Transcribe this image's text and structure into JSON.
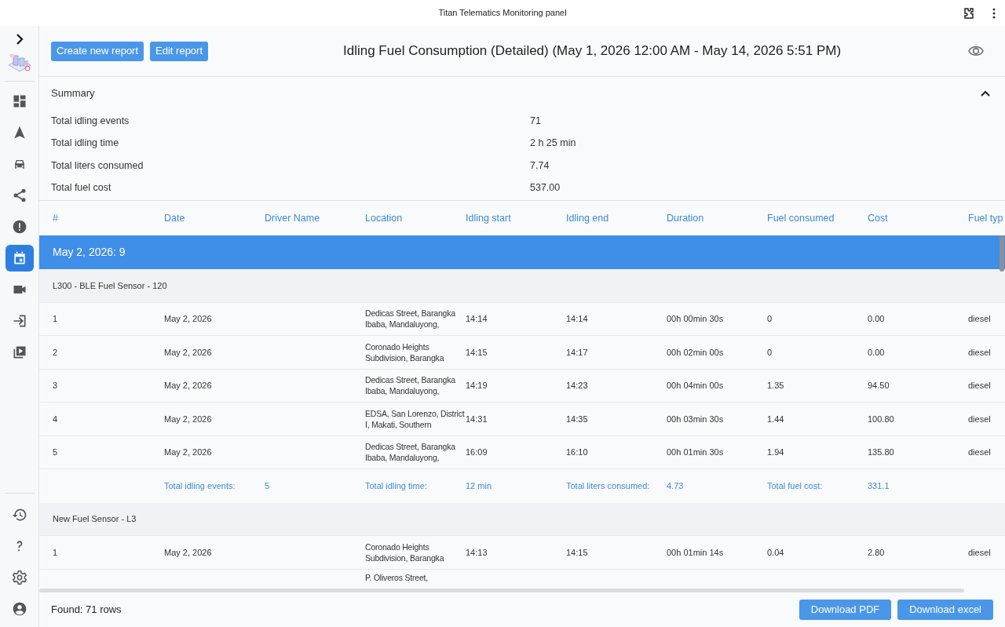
{
  "window": {
    "title": "Titan Telematics Monitoring panel"
  },
  "sidebar": {
    "items": [
      {
        "kind": "dashboard",
        "selected": false
      },
      {
        "kind": "navigation",
        "selected": false
      },
      {
        "kind": "car",
        "selected": false
      },
      {
        "kind": "share",
        "selected": false
      },
      {
        "kind": "alert",
        "selected": false
      },
      {
        "kind": "calendar",
        "selected": true
      },
      {
        "kind": "video",
        "selected": false
      },
      {
        "kind": "login",
        "selected": false
      },
      {
        "kind": "library",
        "selected": false
      }
    ],
    "bottom_items": [
      {
        "kind": "history"
      },
      {
        "kind": "help"
      },
      {
        "kind": "settings"
      },
      {
        "kind": "account"
      }
    ]
  },
  "toolbar": {
    "buttons": [
      "Create new report",
      "Edit report"
    ],
    "title": "Idling Fuel Consumption (Detailed) (May 1, 2026 12:00 AM - May 14, 2026 5:51 PM)"
  },
  "summary": {
    "title": "Summary",
    "expanded": true,
    "rows": [
      {
        "label": "Total idling events",
        "value": "71"
      },
      {
        "label": "Total idling time",
        "value": "2 h 25 min"
      },
      {
        "label": "Total liters consumed",
        "value": "7.74"
      },
      {
        "label": "Total fuel cost",
        "value": "537.00"
      }
    ]
  },
  "table": {
    "columns": [
      "#",
      "Date",
      "Driver Name",
      "Location",
      "Idling start",
      "Idling end",
      "Duration",
      "Fuel consumed",
      "Cost",
      "Fuel typ"
    ],
    "groups": [
      {
        "label": "May 2, 2026: 9",
        "subgroups": [
          {
            "label": "L300 - BLE Fuel Sensor - 120",
            "rows": [
              {
                "number": "1",
                "date": "May 2, 2026",
                "location": "Dedicas Street, Barangka Ibaba, Mandaluyong,",
                "idling_start": "14:14",
                "idling_end": "14:14",
                "duration": "00h 00min 30s",
                "fuel_consumed": "0",
                "cost": "0.00",
                "fuel_type": "diesel"
              },
              {
                "number": "2",
                "date": "May 2, 2026",
                "location": "Coronado Heights Subdivision, Barangka",
                "idling_start": "14:15",
                "idling_end": "14:17",
                "duration": "00h 02min 00s",
                "fuel_consumed": "0",
                "cost": "0.00",
                "fuel_type": "diesel"
              },
              {
                "number": "3",
                "date": "May 2, 2026",
                "location": "Dedicas Street, Barangka Ibaba, Mandaluyong,",
                "idling_start": "14:19",
                "idling_end": "14:23",
                "duration": "00h 04min 00s",
                "fuel_consumed": "1.35",
                "cost": "94.50",
                "fuel_type": "diesel"
              },
              {
                "number": "4",
                "date": "May 2, 2026",
                "location": "EDSA, San Lorenzo, District I, Makati, Southern",
                "idling_start": "14:31",
                "idling_end": "14:35",
                "duration": "00h 03min 30s",
                "fuel_consumed": "1.44",
                "cost": "100.80",
                "fuel_type": "diesel"
              },
              {
                "number": "5",
                "date": "May 2, 2026",
                "location": "Dedicas Street, Barangka Ibaba, Mandaluyong,",
                "idling_start": "16:09",
                "idling_end": "16:10",
                "duration": "00h 01min 30s",
                "fuel_consumed": "1.94",
                "cost": "135.80",
                "fuel_type": "diesel"
              }
            ],
            "totals": [
              {
                "label": "Total idling events:",
                "value": "5"
              },
              {
                "label": "Total idling time:",
                "value": "12 min"
              },
              {
                "label": "Total liters consumed:",
                "value": "4.73"
              },
              {
                "label": "Total fuel cost:",
                "value": "331.1"
              }
            ]
          },
          {
            "label": "New Fuel Sensor - L3",
            "rows": [
              {
                "number": "1",
                "date": "May 2, 2026",
                "location": "Coronado Heights Subdivision, Barangka",
                "idling_start": "14:13",
                "idling_end": "14:15",
                "duration": "00h 01min 14s",
                "fuel_consumed": "0.04",
                "cost": "2.80",
                "fuel_type": "diesel"
              },
              {
                "location": "P. Oliveros Street,"
              }
            ]
          }
        ]
      }
    ]
  },
  "footer": {
    "found": "Found: 71 rows",
    "buttons": [
      "Download PDF",
      "Download excel"
    ]
  }
}
